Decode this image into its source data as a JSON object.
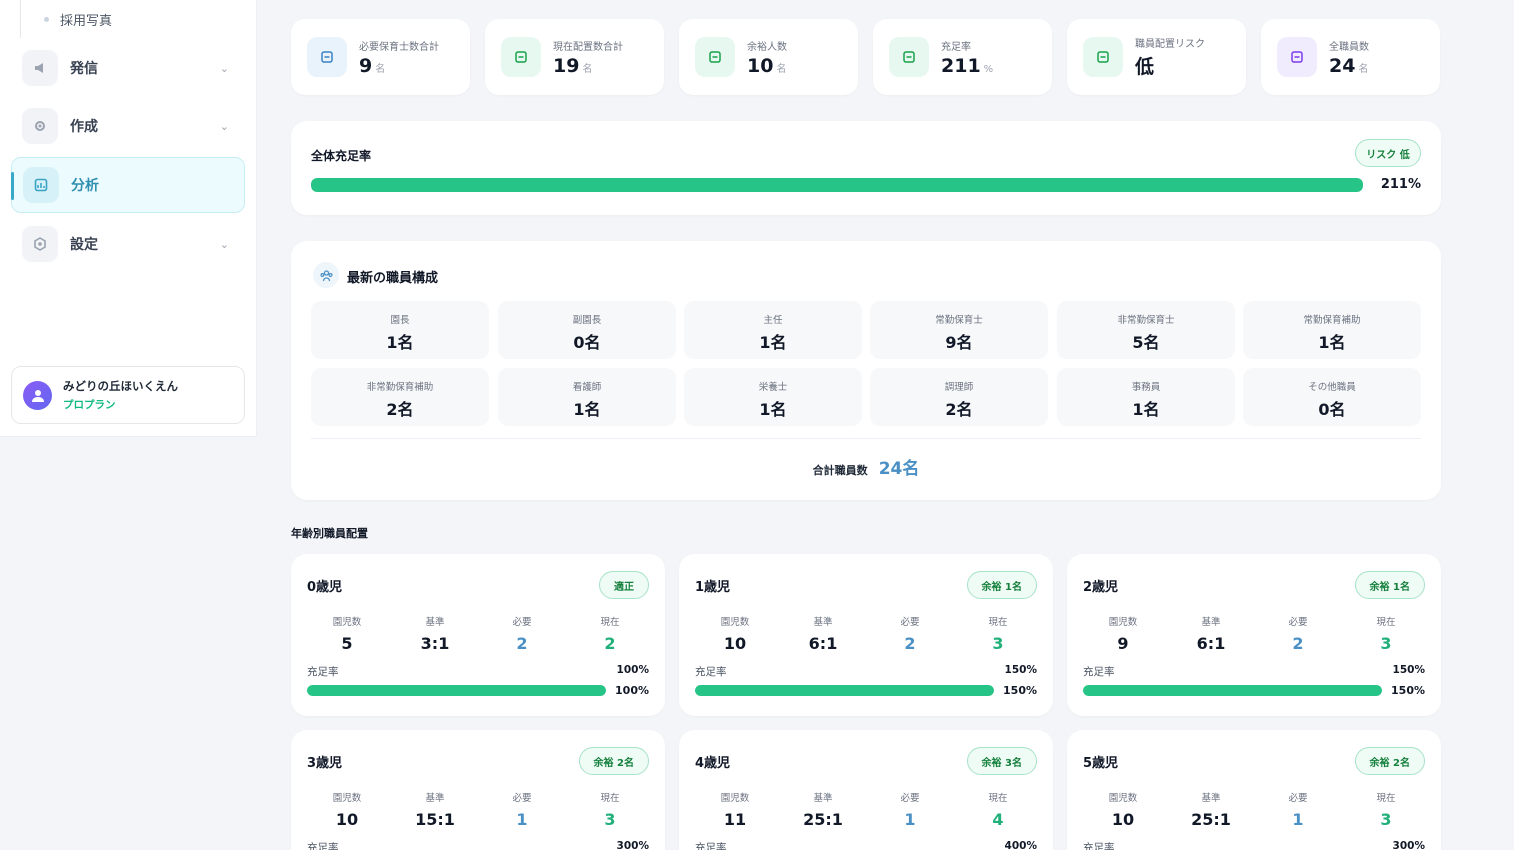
{
  "sidebar": {
    "sub_item": "採用写真",
    "items": [
      {
        "label": "発信",
        "icon": "megaphone-icon",
        "expandable": true,
        "active": false
      },
      {
        "label": "作成",
        "icon": "gear-icon",
        "expandable": true,
        "active": false
      },
      {
        "label": "分析",
        "icon": "chart-icon",
        "expandable": false,
        "active": true
      },
      {
        "label": "設定",
        "icon": "settings-icon",
        "expandable": true,
        "active": false
      }
    ],
    "user": {
      "name": "みどりの丘ほいくえん",
      "plan": "プロプラン"
    }
  },
  "stats": [
    {
      "label": "必要保育士数合計",
      "value": "9",
      "unit": "名",
      "icon": "calculator-icon",
      "color": "#e8f3fb",
      "fg": "#3b82c4"
    },
    {
      "label": "現在配置数合計",
      "value": "19",
      "unit": "名",
      "icon": "people-icon",
      "color": "#e6f8ef",
      "fg": "#16a34a"
    },
    {
      "label": "余裕人数",
      "value": "10",
      "unit": "名",
      "icon": "double-check-icon",
      "color": "#e6f8ef",
      "fg": "#16a34a"
    },
    {
      "label": "充足率",
      "value": "211",
      "unit": "%",
      "icon": "percent-icon",
      "color": "#e6f8ef",
      "fg": "#16a34a"
    },
    {
      "label": "職員配置リスク",
      "value": "低",
      "unit": "",
      "icon": "shield-check-icon",
      "color": "#e6f8ef",
      "fg": "#16a34a"
    },
    {
      "label": "全職員数",
      "value": "24",
      "unit": "名",
      "icon": "users-icon",
      "color": "#f1ecfd",
      "fg": "#7c3aed"
    }
  ],
  "overall": {
    "title": "全体充足率",
    "badge": "リスク 低",
    "value": "211%",
    "fill": 1.0
  },
  "staff": {
    "title": "最新の職員構成",
    "roles": [
      {
        "label": "園長",
        "value": "1名"
      },
      {
        "label": "副園長",
        "value": "0名"
      },
      {
        "label": "主任",
        "value": "1名"
      },
      {
        "label": "常勤保育士",
        "value": "9名"
      },
      {
        "label": "非常勤保育士",
        "value": "5名"
      },
      {
        "label": "常勤保育補助",
        "value": "1名"
      },
      {
        "label": "非常勤保育補助",
        "value": "2名"
      },
      {
        "label": "看護師",
        "value": "1名"
      },
      {
        "label": "栄養士",
        "value": "1名"
      },
      {
        "label": "調理師",
        "value": "2名"
      },
      {
        "label": "事務員",
        "value": "1名"
      },
      {
        "label": "その他職員",
        "value": "0名"
      }
    ],
    "total_label": "合計職員数",
    "total_value": "24名"
  },
  "age_section": {
    "title": "年齢別職員配置",
    "col_labels": [
      "園児数",
      "基準",
      "必要",
      "現在"
    ],
    "rate_label": "充足率",
    "cards": [
      {
        "age": "0歳児",
        "badge": "適正",
        "children": "5",
        "ratio": "3:1",
        "required": "2",
        "current": "2",
        "rate": "100%",
        "fill": 1.0
      },
      {
        "age": "1歳児",
        "badge": "余裕 1名",
        "children": "10",
        "ratio": "6:1",
        "required": "2",
        "current": "3",
        "rate": "150%",
        "fill": 1.0
      },
      {
        "age": "2歳児",
        "badge": "余裕 1名",
        "children": "9",
        "ratio": "6:1",
        "required": "2",
        "current": "3",
        "rate": "150%",
        "fill": 1.0
      },
      {
        "age": "3歳児",
        "badge": "余裕 2名",
        "children": "10",
        "ratio": "15:1",
        "required": "1",
        "current": "3",
        "rate": "300%",
        "fill": 1.0
      },
      {
        "age": "4歳児",
        "badge": "余裕 3名",
        "children": "11",
        "ratio": "25:1",
        "required": "1",
        "current": "4",
        "rate": "400%",
        "fill": 1.0
      },
      {
        "age": "5歳児",
        "badge": "余裕 2名",
        "children": "10",
        "ratio": "25:1",
        "required": "1",
        "current": "3",
        "rate": "300%",
        "fill": 1.0
      }
    ]
  },
  "colors": {
    "accent": "#26c587",
    "required": "#4a90c4",
    "current": "#22b07a",
    "total": "#4a90c4"
  }
}
